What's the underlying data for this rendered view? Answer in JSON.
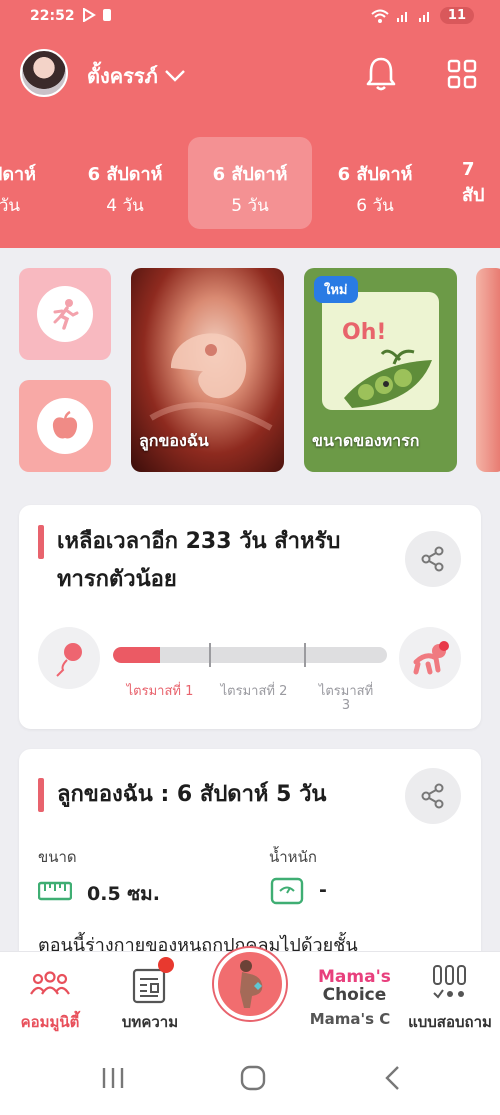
{
  "status": {
    "time": "22:52",
    "battery": "11"
  },
  "header": {
    "username": "ตั้งครรภ์"
  },
  "weeks": [
    {
      "week": "สัปดาห์",
      "day": "วัน"
    },
    {
      "week": "6 สัปดาห์",
      "day": "4 วัน"
    },
    {
      "week": "6 สัปดาห์",
      "day": "5 วัน"
    },
    {
      "week": "6 สัปดาห์",
      "day": "6 วัน"
    },
    {
      "week": "7 สัป",
      "day": ""
    }
  ],
  "cards": {
    "baby": "ลูกของฉัน",
    "size": "ขนาดของทารก",
    "badge_new": "ใหม่",
    "size_art_text": "Oh!"
  },
  "countdown": {
    "title_line1": "เหลือเวลาอีก 233 วัน สำหรับ",
    "title_line2": "ทารกตัวน้อย",
    "progress_percent": 17,
    "trimesters": [
      "ไตรมาสที่ 1",
      "ไตรมาสที่ 2",
      "ไตรมาสที่",
      "3"
    ],
    "active_color": "#eb5a64"
  },
  "baby_info": {
    "title": "ลูกของฉัน : 6 สัปดาห์ 5  วัน",
    "size_label": "ขนาด",
    "size_value": "0.5 ซม.",
    "weight_label": "น้ำหนัก",
    "weight_value": "-",
    "body": "ตอนนี้ร่างกายของหนูถูกปกคลุมไปด้วยชั้น"
  },
  "nav": {
    "community": "คอมมูนิตี้",
    "articles": "บทความ",
    "mamas_choice_logo_1": "Mama's",
    "mamas_choice_logo_2": "Choice",
    "mamas_choice": "Mama's C",
    "quiz": "แบบสอบถาม"
  },
  "colors": {
    "brand": "#f16d6f",
    "accent": "#e8636d"
  }
}
